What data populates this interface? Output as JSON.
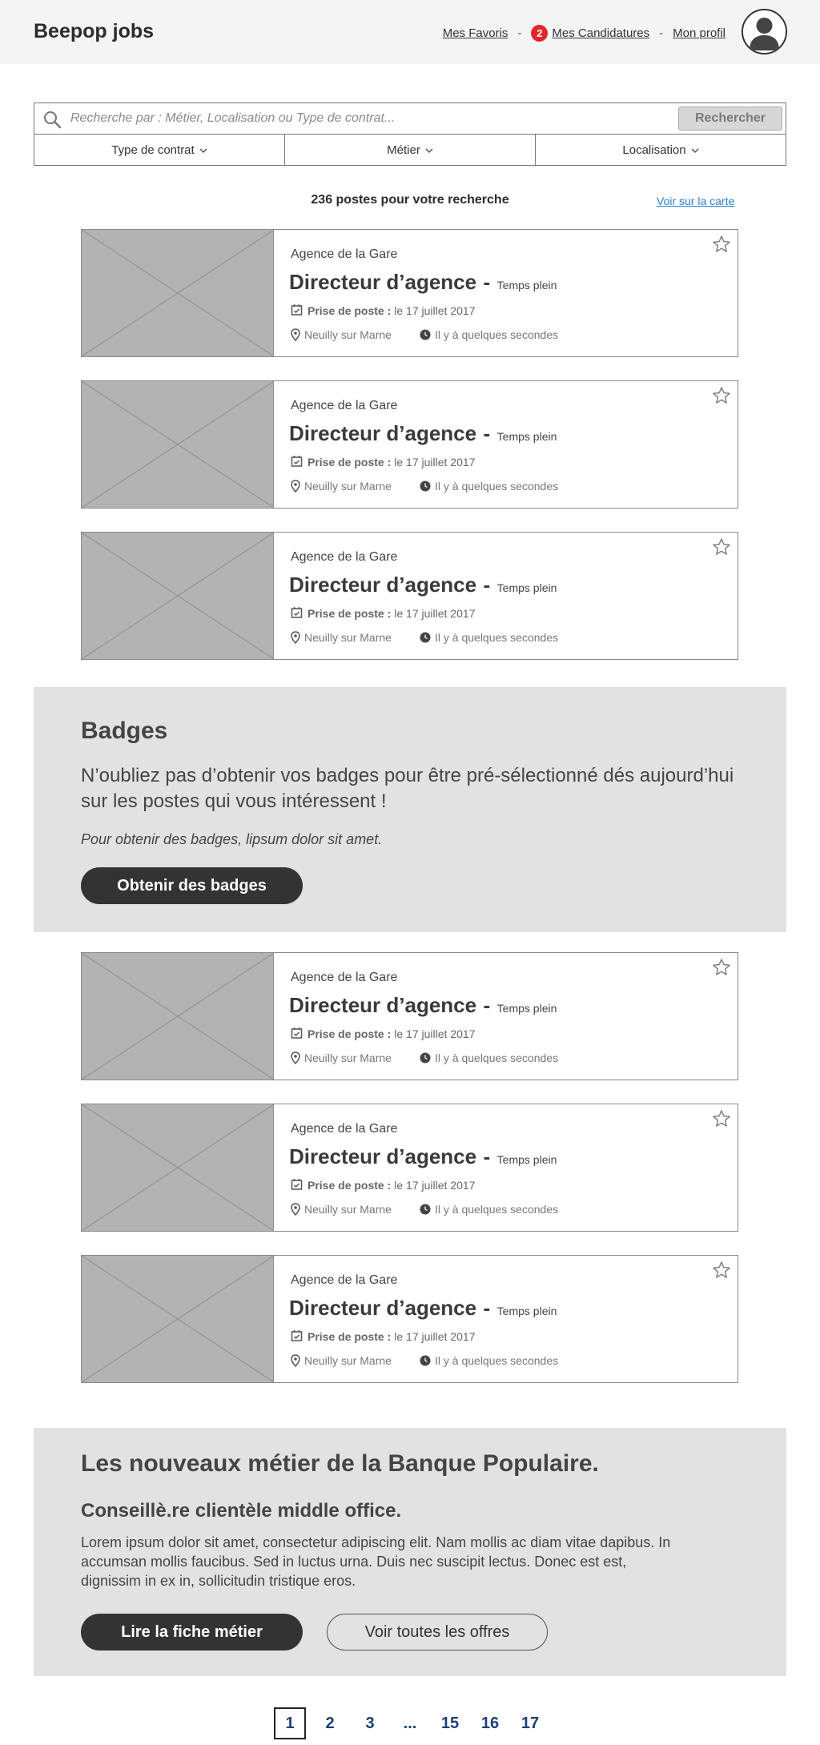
{
  "header": {
    "brand": "Beepop jobs",
    "nav": {
      "favorites": "Mes Favoris",
      "separator": "-",
      "applications_count": "2",
      "applications": "Mes Candidatures",
      "profile": "Mon profil"
    },
    "avatar_icon": "user-avatar-icon"
  },
  "search": {
    "placeholder": "Recherche par : Métier, Localisation ou Type de contrat...",
    "value": "",
    "button_label": "Rechercher",
    "filters": [
      {
        "label": "Type de contrat"
      },
      {
        "label": "Métier"
      },
      {
        "label": "Localisation"
      }
    ]
  },
  "results": {
    "count_text": "236 postes pour votre recherche",
    "map_link": "Voir sur la carte"
  },
  "jobs": [
    {
      "agency": "Agence de la Gare",
      "title": "Directeur d’agence",
      "dash": "-",
      "contract": "Temps plein",
      "start_label": "Prise de poste :",
      "start_date": "le 17 juillet 2017",
      "location": "Neuilly sur Marne",
      "posted": "Il y à quelques secondes"
    },
    {
      "agency": "Agence de la Gare",
      "title": "Directeur d’agence",
      "dash": "-",
      "contract": "Temps plein",
      "start_label": "Prise de poste :",
      "start_date": "le 17 juillet 2017",
      "location": "Neuilly sur Marne",
      "posted": "Il y à quelques secondes"
    },
    {
      "agency": "Agence de la Gare",
      "title": "Directeur d’agence",
      "dash": "-",
      "contract": "Temps plein",
      "start_label": "Prise de poste :",
      "start_date": "le 17 juillet 2017",
      "location": "Neuilly sur Marne",
      "posted": "Il y à quelques secondes"
    },
    {
      "agency": "Agence de la Gare",
      "title": "Directeur d’agence",
      "dash": "-",
      "contract": "Temps plein",
      "start_label": "Prise de poste :",
      "start_date": "le 17 juillet 2017",
      "location": "Neuilly sur Marne",
      "posted": "Il y à quelques secondes"
    },
    {
      "agency": "Agence de la Gare",
      "title": "Directeur d’agence",
      "dash": "-",
      "contract": "Temps plein",
      "start_label": "Prise de poste :",
      "start_date": "le 17 juillet 2017",
      "location": "Neuilly sur Marne",
      "posted": "Il y à quelques secondes"
    },
    {
      "agency": "Agence de la Gare",
      "title": "Directeur d’agence",
      "dash": "-",
      "contract": "Temps plein",
      "start_label": "Prise de poste :",
      "start_date": "le 17 juillet 2017",
      "location": "Neuilly sur Marne",
      "posted": "Il y à quelques secondes"
    }
  ],
  "badges": {
    "title": "Badges",
    "text": "N’oubliez pas d’obtenir vos badges pour être pré-sélectionné dés aujourd’hui sur les postes qui vous intéressent !",
    "note": "Pour obtenir des badges, lipsum dolor sit amet.",
    "button_label": "Obtenir des badges"
  },
  "metier": {
    "title": "Les nouveaux métier de la Banque Populaire.",
    "subtitle": "Conseillè.re clientèle middle office.",
    "text": "Lorem ipsum dolor sit amet, consectetur adipiscing elit. Nam mollis ac diam vitae dapibus. In accumsan mollis faucibus. Sed in luctus urna. Duis nec suscipit lectus. Donec est est, dignissim in ex in, sollicitudin tristique eros.",
    "primary_label": "Lire la fiche métier",
    "secondary_label": "Voir toutes les offres"
  },
  "pagination": {
    "pages": [
      "1",
      "2",
      "3",
      "...",
      "15",
      "16",
      "17"
    ],
    "current": "1"
  },
  "colors": {
    "accent_badge": "#e0262b",
    "link": "#2a7fd4",
    "pagination": "#1f3f7a",
    "dark_button": "#333333",
    "promo_bg": "#e2e2e2"
  },
  "icons": {
    "search": "search-icon",
    "chevron": "chevron-down-icon",
    "calendar": "calendar-check-icon",
    "location": "map-pin-icon",
    "clock": "clock-icon",
    "favorite": "star-outline-icon",
    "thumbnail": "image-placeholder-icon"
  }
}
